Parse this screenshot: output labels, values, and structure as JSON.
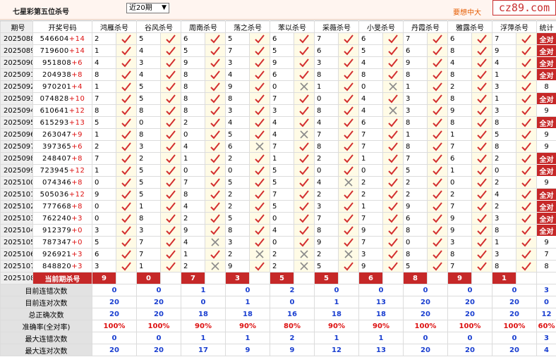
{
  "header": {
    "title": "七星彩第五位杀号",
    "period_select": "近20期",
    "link_text": "要想中大",
    "logo": "cz89.com"
  },
  "columns": [
    "期号",
    "开奖号码",
    "鸿雁杀号",
    "谷风杀号",
    "周南杀号",
    "荡之杀号",
    "苯以杀号",
    "采薇杀号",
    "小旻杀号",
    "丹霞杀号",
    "雅露杀号",
    "浮萍杀号",
    "统计"
  ],
  "rows": [
    {
      "period": "2025088",
      "lottery": "546604",
      "extra": "+14",
      "kills": [
        2,
        5,
        6,
        5,
        6,
        7,
        6,
        7,
        6,
        7
      ],
      "hits": [
        1,
        1,
        1,
        1,
        1,
        1,
        1,
        1,
        1,
        1
      ],
      "stat": "全对"
    },
    {
      "period": "2025089",
      "lottery": "719600",
      "extra": "+14",
      "kills": [
        1,
        4,
        5,
        7,
        5,
        6,
        5,
        6,
        8,
        9
      ],
      "hits": [
        1,
        1,
        1,
        1,
        1,
        1,
        1,
        1,
        1,
        1
      ],
      "stat": "全对"
    },
    {
      "period": "2025090",
      "lottery": "951808",
      "extra": "+6",
      "kills": [
        4,
        3,
        9,
        3,
        9,
        3,
        4,
        9,
        4,
        4
      ],
      "hits": [
        1,
        1,
        1,
        1,
        1,
        1,
        1,
        1,
        1,
        1
      ],
      "stat": "全对"
    },
    {
      "period": "2025091",
      "lottery": "204938",
      "extra": "+8",
      "kills": [
        8,
        4,
        8,
        4,
        6,
        8,
        8,
        8,
        8,
        1
      ],
      "hits": [
        1,
        1,
        1,
        1,
        1,
        1,
        1,
        1,
        1,
        1
      ],
      "stat": "全对"
    },
    {
      "period": "2025092",
      "lottery": "970201",
      "extra": "+4",
      "kills": [
        1,
        5,
        8,
        9,
        0,
        1,
        0,
        1,
        2,
        3
      ],
      "hits": [
        1,
        1,
        1,
        1,
        0,
        1,
        0,
        1,
        1,
        1
      ],
      "stat": "8"
    },
    {
      "period": "2025093",
      "lottery": "074828",
      "extra": "+10",
      "kills": [
        7,
        5,
        8,
        8,
        7,
        0,
        4,
        3,
        8,
        1
      ],
      "hits": [
        1,
        1,
        1,
        1,
        1,
        1,
        1,
        1,
        1,
        1
      ],
      "stat": "全对"
    },
    {
      "period": "2025094",
      "lottery": "610641",
      "extra": "+12",
      "kills": [
        8,
        8,
        8,
        3,
        3,
        8,
        4,
        3,
        9,
        3
      ],
      "hits": [
        1,
        1,
        1,
        1,
        1,
        1,
        0,
        1,
        1,
        1
      ],
      "stat": "9"
    },
    {
      "period": "2025095",
      "lottery": "615293",
      "extra": "+13",
      "kills": [
        5,
        0,
        2,
        4,
        4,
        4,
        6,
        8,
        8,
        8
      ],
      "hits": [
        1,
        1,
        1,
        1,
        1,
        1,
        1,
        1,
        1,
        1
      ],
      "stat": "全对"
    },
    {
      "period": "2025096",
      "lottery": "263047",
      "extra": "+9",
      "kills": [
        1,
        8,
        0,
        5,
        4,
        7,
        7,
        1,
        1,
        5
      ],
      "hits": [
        1,
        1,
        1,
        1,
        0,
        1,
        1,
        1,
        1,
        1
      ],
      "stat": "9"
    },
    {
      "period": "2025097",
      "lottery": "397365",
      "extra": "+6",
      "kills": [
        2,
        3,
        4,
        6,
        7,
        8,
        7,
        8,
        7,
        8
      ],
      "hits": [
        1,
        1,
        1,
        0,
        1,
        1,
        1,
        1,
        1,
        1
      ],
      "stat": "9"
    },
    {
      "period": "2025098",
      "lottery": "248407",
      "extra": "+8",
      "kills": [
        7,
        2,
        1,
        2,
        1,
        2,
        1,
        7,
        6,
        2
      ],
      "hits": [
        1,
        1,
        1,
        1,
        1,
        1,
        1,
        1,
        1,
        1
      ],
      "stat": "全对"
    },
    {
      "period": "2025099",
      "lottery": "723945",
      "extra": "+12",
      "kills": [
        1,
        5,
        0,
        0,
        5,
        0,
        0,
        5,
        1,
        0
      ],
      "hits": [
        1,
        1,
        1,
        1,
        1,
        1,
        1,
        1,
        1,
        1
      ],
      "stat": "全对"
    },
    {
      "period": "2025100",
      "lottery": "074346",
      "extra": "+8",
      "kills": [
        0,
        5,
        7,
        5,
        5,
        4,
        2,
        2,
        0,
        2
      ],
      "hits": [
        1,
        1,
        1,
        1,
        1,
        0,
        1,
        1,
        1,
        1
      ],
      "stat": "9"
    },
    {
      "period": "2025101",
      "lottery": "505036",
      "extra": "+12",
      "kills": [
        9,
        5,
        8,
        2,
        7,
        2,
        2,
        2,
        2,
        4
      ],
      "hits": [
        1,
        1,
        1,
        1,
        1,
        1,
        1,
        1,
        1,
        1
      ],
      "stat": "全对"
    },
    {
      "period": "2025102",
      "lottery": "777668",
      "extra": "+8",
      "kills": [
        0,
        1,
        4,
        2,
        5,
        3,
        1,
        9,
        7,
        2
      ],
      "hits": [
        1,
        1,
        1,
        1,
        1,
        1,
        1,
        1,
        1,
        1
      ],
      "stat": "全对"
    },
    {
      "period": "2025103",
      "lottery": "762240",
      "extra": "+3",
      "kills": [
        0,
        8,
        2,
        5,
        0,
        7,
        7,
        6,
        9,
        3
      ],
      "hits": [
        1,
        1,
        1,
        1,
        1,
        1,
        1,
        1,
        1,
        1
      ],
      "stat": "全对"
    },
    {
      "period": "2025104",
      "lottery": "912379",
      "extra": "+0",
      "kills": [
        3,
        3,
        9,
        8,
        4,
        8,
        9,
        8,
        9,
        8
      ],
      "hits": [
        1,
        1,
        1,
        1,
        1,
        1,
        1,
        1,
        1,
        1
      ],
      "stat": "全对"
    },
    {
      "period": "2025105",
      "lottery": "787347",
      "extra": "+0",
      "kills": [
        5,
        7,
        4,
        3,
        0,
        9,
        7,
        0,
        3,
        1
      ],
      "hits": [
        1,
        1,
        0,
        1,
        1,
        1,
        1,
        1,
        1,
        1
      ],
      "stat": "9"
    },
    {
      "period": "2025106",
      "lottery": "926921",
      "extra": "+3",
      "kills": [
        6,
        7,
        1,
        2,
        2,
        2,
        3,
        8,
        8,
        3
      ],
      "hits": [
        1,
        1,
        1,
        0,
        0,
        0,
        1,
        1,
        1,
        1
      ],
      "stat": "7"
    },
    {
      "period": "2025107",
      "lottery": "848820",
      "extra": "+3",
      "kills": [
        3,
        1,
        2,
        9,
        2,
        5,
        9,
        5,
        7,
        8
      ],
      "hits": [
        1,
        1,
        0,
        1,
        0,
        1,
        1,
        1,
        1,
        1
      ],
      "stat": "8"
    }
  ],
  "current": {
    "period": "2025108",
    "label": "当前期杀号",
    "kills": [
      "9",
      "0",
      "7",
      "3",
      "5",
      "5",
      "6",
      "8",
      "9",
      "1"
    ]
  },
  "summary": [
    {
      "label": "目前连错次数",
      "values": [
        "0",
        "0",
        "1",
        "0",
        "2",
        "0",
        "0",
        "0",
        "0",
        "0",
        "3"
      ],
      "style": "bl"
    },
    {
      "label": "目前连对次数",
      "values": [
        "20",
        "20",
        "0",
        "1",
        "0",
        "1",
        "13",
        "20",
        "20",
        "20",
        "0"
      ],
      "style": "bl"
    },
    {
      "label": "总正确次数",
      "values": [
        "20",
        "20",
        "18",
        "18",
        "16",
        "18",
        "18",
        "20",
        "20",
        "20",
        "12"
      ],
      "style": "bl"
    },
    {
      "label": "准确率(全对率)",
      "values": [
        "100%",
        "100%",
        "90%",
        "90%",
        "80%",
        "90%",
        "90%",
        "100%",
        "100%",
        "100%",
        "60%"
      ],
      "style": "rd"
    },
    {
      "label": "最大连错次数",
      "values": [
        "0",
        "0",
        "1",
        "1",
        "2",
        "1",
        "1",
        "0",
        "0",
        "0",
        "3"
      ],
      "style": "bl"
    },
    {
      "label": "最大连对次数",
      "values": [
        "20",
        "20",
        "17",
        "9",
        "9",
        "12",
        "13",
        "20",
        "20",
        "20",
        "4"
      ],
      "style": "bl"
    }
  ],
  "colors": {
    "hit": "#d32f2f",
    "miss": "#8a8a8a",
    "accent": "#c62828",
    "blue": "#1a3fd0"
  },
  "icons": {
    "hit": "check-icon",
    "miss": "cross-icon"
  }
}
